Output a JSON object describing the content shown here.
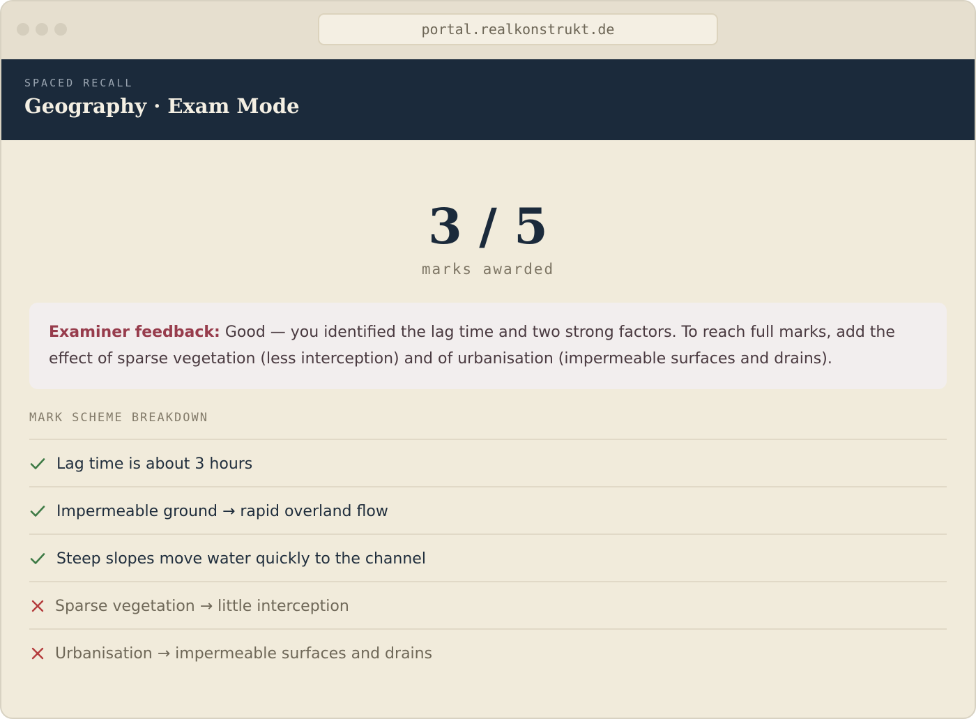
{
  "browser": {
    "url": "portal.realkonstrukt.de"
  },
  "header": {
    "eyebrow": "SPACED RECALL",
    "title": "Geography · Exam Mode"
  },
  "result": {
    "score": "3 / 5",
    "caption": "marks awarded"
  },
  "feedback": {
    "label": "Examiner feedback:",
    "text": "Good — you identified the lag time and two strong factors. To reach full marks, add the effect of sparse vegetation (less interception) and of urbanisation (impermeable surfaces and drains)."
  },
  "breakdown": {
    "label": "MARK SCHEME BREAKDOWN",
    "items": [
      {
        "text": "Lag time is about 3 hours",
        "met": true
      },
      {
        "text": "Impermeable ground → rapid overland flow",
        "met": true
      },
      {
        "text": "Steep slopes move water quickly to the channel",
        "met": true
      },
      {
        "text": "Sparse vegetation → little interception",
        "met": false
      },
      {
        "text": "Urbanisation → impermeable surfaces and drains",
        "met": false
      }
    ]
  },
  "colors": {
    "met": "#3d7a45",
    "unmet": "#b43c3c",
    "header_bg": "#1b2a3b",
    "accent": "#973c4c"
  },
  "icons": {
    "met": "check-icon",
    "unmet": "cross-icon"
  }
}
